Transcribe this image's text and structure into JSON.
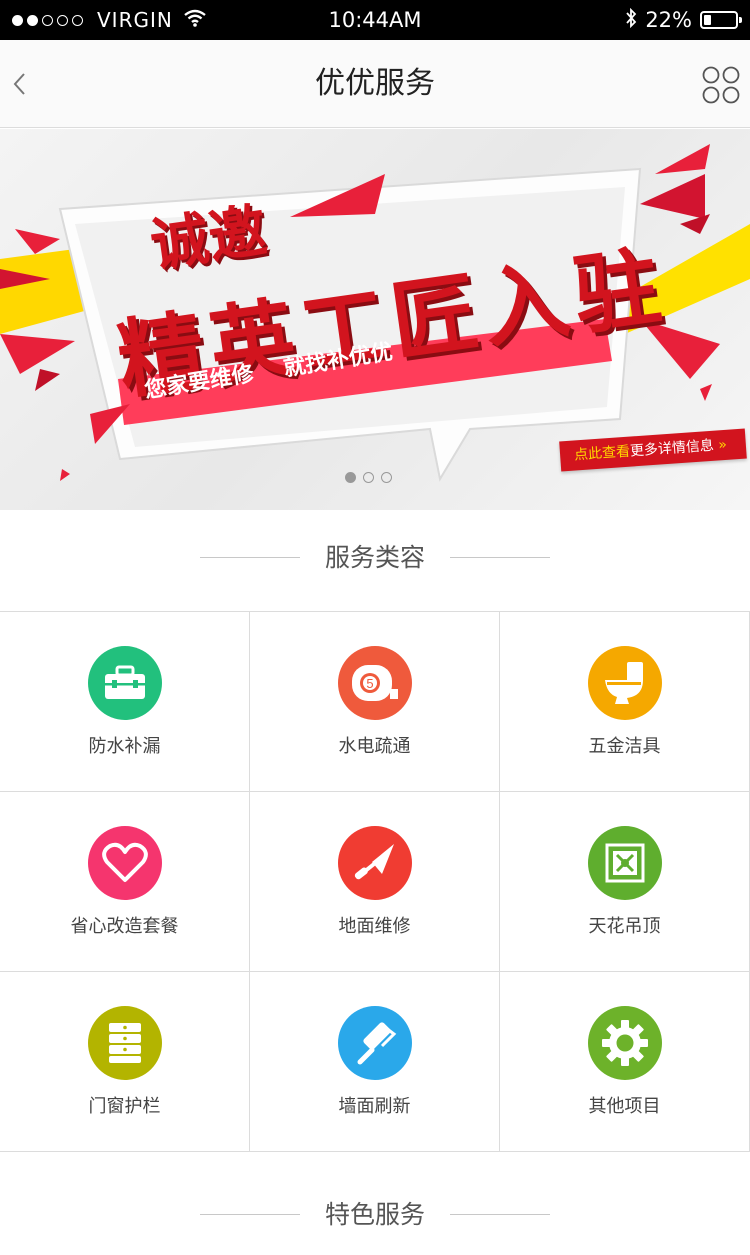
{
  "status_bar": {
    "carrier": "VIRGIN",
    "time": "10:44AM",
    "battery": "22%",
    "battery_level": 0.22,
    "signal_dots": [
      "on",
      "on",
      "off",
      "off",
      "off"
    ]
  },
  "nav": {
    "title": "优优服务",
    "back_icon": "chevron-left-icon",
    "menu_icon": "four-circles-grid-icon"
  },
  "banner": {
    "headline_1": "诚邀",
    "headline_2": "精英工匠入驻",
    "slogan": "您家要维修    就找补优优",
    "link_highlight": "点此查看",
    "link_rest": "更多详情信息",
    "link_arrow": "»",
    "page_count": 3,
    "active_page": 1,
    "colors": {
      "accent": "#d2141e",
      "ribbon": "#ff3d5a",
      "yellow": "#ffd800"
    }
  },
  "services": {
    "heading": "服务类容",
    "items": [
      {
        "label": "防水补漏",
        "icon": "toolbox-icon",
        "color": "#22c07d"
      },
      {
        "label": "水电疏通",
        "icon": "tape-measure-icon",
        "color": "#ef5a3c"
      },
      {
        "label": "五金洁具",
        "icon": "toilet-icon",
        "color": "#f5a800"
      },
      {
        "label": "省心改造套餐",
        "icon": "heart-icon",
        "color": "#f5356e"
      },
      {
        "label": "地面维修",
        "icon": "trowel-icon",
        "color": "#f03c32"
      },
      {
        "label": "天花吊顶",
        "icon": "ceiling-tile-icon",
        "color": "#5fae2e"
      },
      {
        "label": "门窗护栏",
        "icon": "window-rail-icon",
        "color": "#b3b400"
      },
      {
        "label": "墙面刷新",
        "icon": "paint-roller-icon",
        "color": "#2aa8ea"
      },
      {
        "label": "其他项目",
        "icon": "gear-icon",
        "color": "#6db22a"
      }
    ]
  },
  "featured": {
    "heading": "特色服务"
  }
}
